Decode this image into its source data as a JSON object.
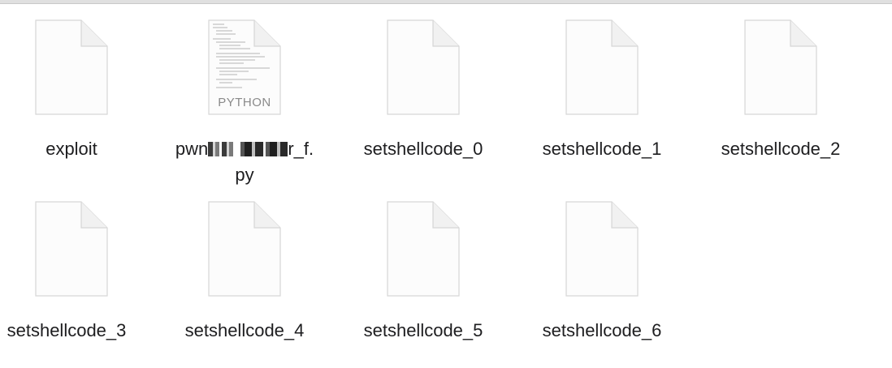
{
  "files": [
    {
      "name": "exploit",
      "icon": "blank-document-icon"
    },
    {
      "name_start": "pwn",
      "name_end": "r_f.",
      "name_line2": "py",
      "icon": "python-document-icon",
      "ext_label": "PYTHON"
    },
    {
      "name": "setshellcode_0",
      "icon": "blank-document-icon"
    },
    {
      "name": "setshellcode_1",
      "icon": "blank-document-icon"
    },
    {
      "name": "setshellcode_2",
      "icon": "blank-document-icon"
    },
    {
      "name": "setshellcode_3",
      "icon": "blank-document-icon"
    },
    {
      "name": "setshellcode_4",
      "icon": "blank-document-icon"
    },
    {
      "name": "setshellcode_5",
      "icon": "blank-document-icon"
    },
    {
      "name": "setshellcode_6",
      "icon": "blank-document-icon"
    }
  ]
}
